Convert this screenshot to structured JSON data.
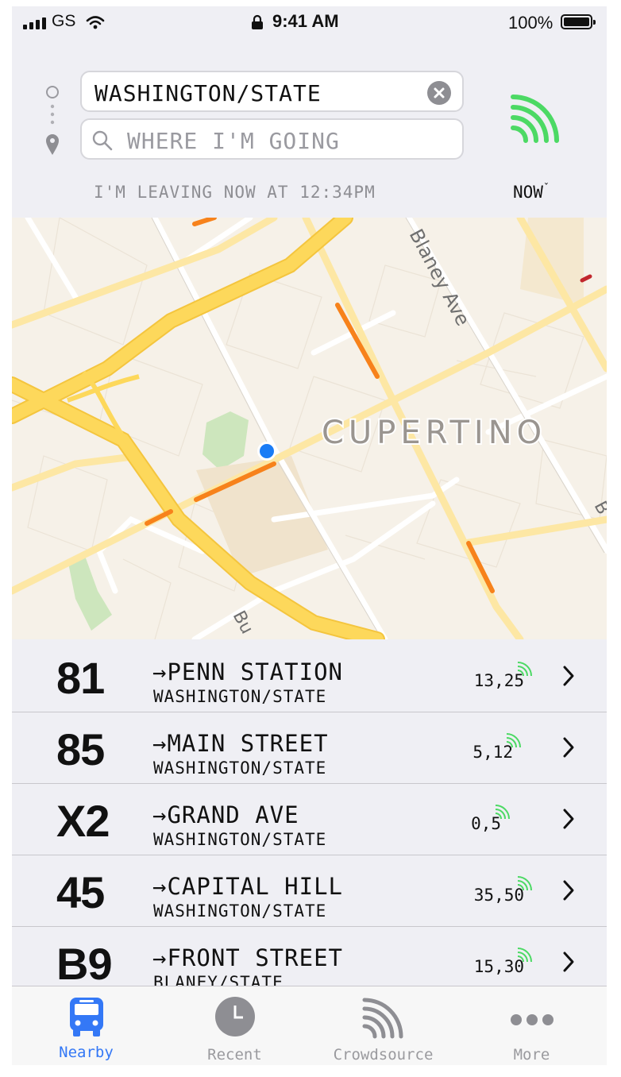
{
  "status_bar": {
    "carrier": "GS",
    "time": "9:41 AM",
    "battery": "100%"
  },
  "search": {
    "origin": "WASHINGTON/STATE",
    "destination_placeholder": "WHERE I'M GOING",
    "leaving_text": "I'M LEAVING NOW AT 12:34PM",
    "time_selector": "NOW"
  },
  "map": {
    "city_label": "CUPERTINO",
    "street_labels": [
      "Blaney Ave",
      "Bu",
      "B"
    ]
  },
  "routes": [
    {
      "number": "81",
      "destination": "PENN STATION",
      "stop": "WASHINGTON/STATE",
      "times": "13,25"
    },
    {
      "number": "85",
      "destination": "MAIN STREET",
      "stop": "WASHINGTON/STATE",
      "times": "5,12"
    },
    {
      "number": "X2",
      "destination": "GRAND AVE",
      "stop": "WASHINGTON/STATE",
      "times": "0,5"
    },
    {
      "number": "45",
      "destination": "CAPITAL HILL",
      "stop": "WASHINGTON/STATE",
      "times": "35,50"
    },
    {
      "number": "B9",
      "destination": "FRONT STREET",
      "stop": "BLANEY/STATE",
      "times": "15,30"
    }
  ],
  "tabs": [
    {
      "label": "Nearby",
      "icon": "bus-icon",
      "active": true
    },
    {
      "label": "Recent",
      "icon": "clock-icon",
      "active": false
    },
    {
      "label": "Crowdsource",
      "icon": "live-signal-icon",
      "active": false
    },
    {
      "label": "More",
      "icon": "more-dots-icon",
      "active": false
    }
  ],
  "colors": {
    "accent": "#3478f6",
    "live": "#4cd964",
    "road_major": "#fdd85b",
    "traffic": "#f7821b",
    "location": "#1a7cf5"
  }
}
